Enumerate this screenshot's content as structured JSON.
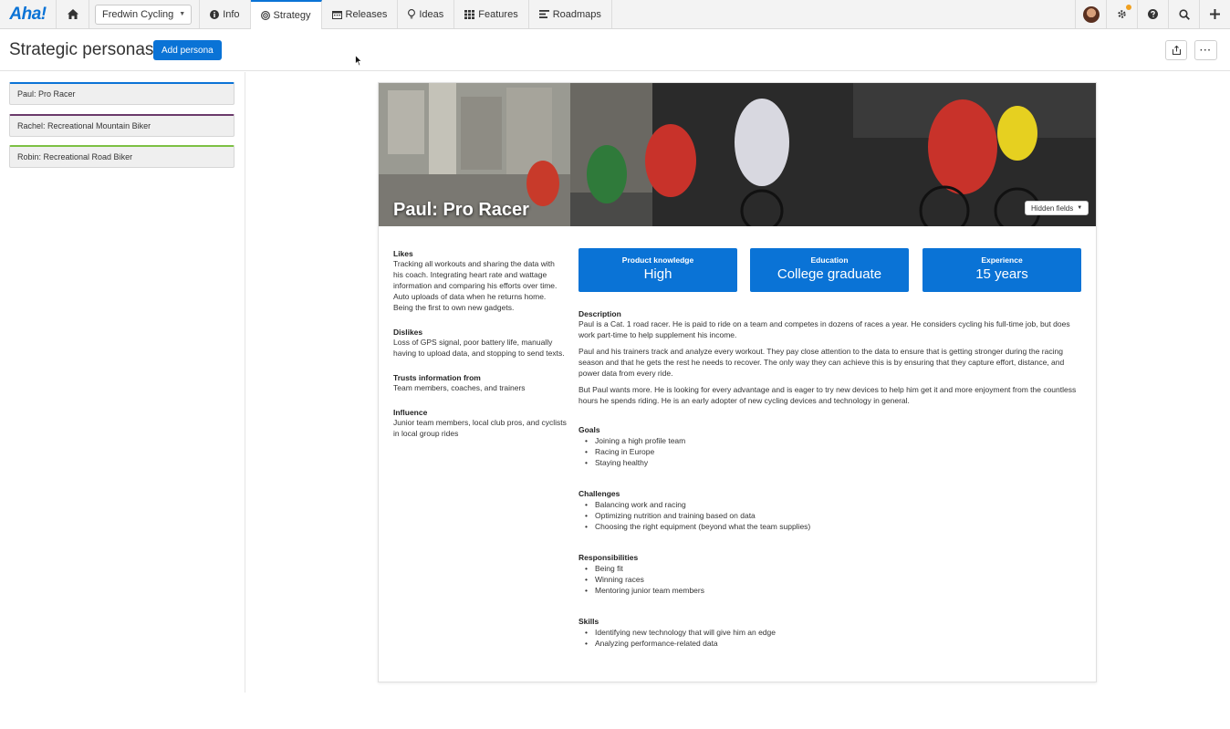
{
  "nav": {
    "logo": "Aha!",
    "workspace": "Fredwin Cycling",
    "tabs": [
      {
        "label": "Info",
        "icon": "info-icon"
      },
      {
        "label": "Strategy",
        "icon": "target-icon"
      },
      {
        "label": "Releases",
        "icon": "calendar-icon"
      },
      {
        "label": "Ideas",
        "icon": "lightbulb-icon"
      },
      {
        "label": "Features",
        "icon": "grid-icon"
      },
      {
        "label": "Roadmaps",
        "icon": "roadmap-icon"
      }
    ],
    "active_tab": "Strategy",
    "accent_color": "#0a73d6",
    "notification_color": "#f0a020"
  },
  "header": {
    "title": "Strategic personas",
    "add_button": "Add persona"
  },
  "sidebar": {
    "items": [
      {
        "label": "Paul: Pro Racer",
        "color": "#0a73d6"
      },
      {
        "label": "Rachel: Recreational Mountain Biker",
        "color": "#6b3a6b"
      },
      {
        "label": "Robin: Recreational Road Biker",
        "color": "#7cc043"
      }
    ]
  },
  "persona": {
    "name": "Paul: Pro Racer",
    "hidden_fields": "Hidden fields",
    "likes_label": "Likes",
    "likes": "Tracking all workouts and sharing the data with his coach. Integrating heart rate and wattage information and comparing his efforts over time. Auto uploads of data when he returns home. Being the first to own new gadgets.",
    "dislikes_label": "Dislikes",
    "dislikes": "Loss of GPS signal, poor battery life, manually having to upload data, and stopping to send texts.",
    "trusts_label": "Trusts information from",
    "trusts": "Team members, coaches, and trainers",
    "influence_label": "Influence",
    "influence": "Junior team members, local club pros, and cyclists in local group rides",
    "stats": [
      {
        "label": "Product knowledge",
        "value": "High"
      },
      {
        "label": "Education",
        "value": "College graduate"
      },
      {
        "label": "Experience",
        "value": "15 years"
      }
    ],
    "description_label": "Description",
    "description": [
      "Paul is a Cat. 1 road racer. He is paid to ride on a team and competes in dozens of races a year. He considers cycling his full-time job, but does work part-time to help supplement his income.",
      "Paul and his trainers track and analyze every workout. They pay close attention to the data to ensure that is getting stronger during the racing season and that he gets the rest he needs to recover. The only way they can achieve this is by ensuring that they capture effort, distance, and power data from every ride.",
      "But Paul wants more. He is looking for every advantage and is eager to try new devices to help him get it and more enjoyment from the countless hours he spends riding. He is an early adopter of new cycling devices and technology in general."
    ],
    "goals_label": "Goals",
    "goals": [
      "Joining a high profile team",
      "Racing in Europe",
      "Staying healthy"
    ],
    "challenges_label": "Challenges",
    "challenges": [
      "Balancing work and racing",
      "Optimizing nutrition and training based on data",
      "Choosing the right equipment (beyond what the team supplies)"
    ],
    "responsibilities_label": "Responsibilities",
    "responsibilities": [
      "Being fit",
      "Winning races",
      "Mentoring junior team members"
    ],
    "skills_label": "Skills",
    "skills": [
      "Identifying new technology that will give him an edge",
      "Analyzing performance-related data"
    ]
  }
}
